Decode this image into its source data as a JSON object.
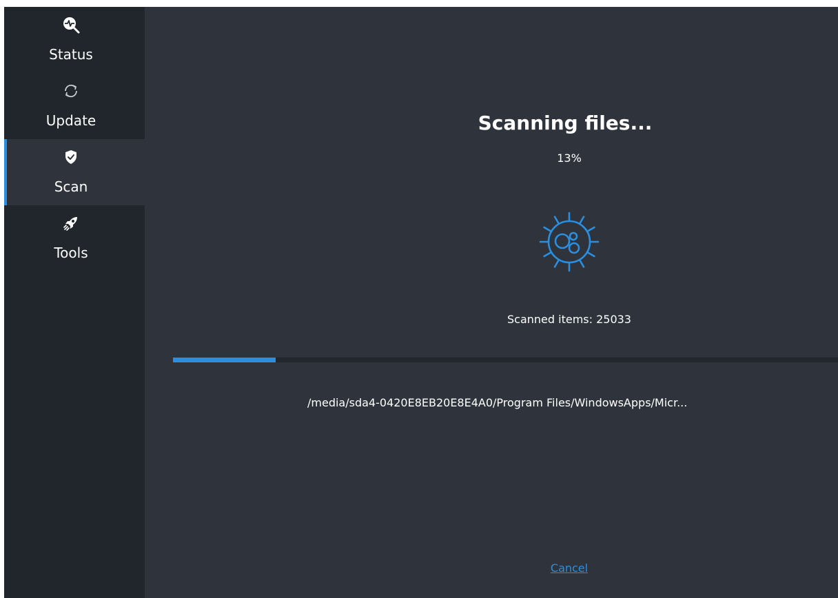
{
  "sidebar": {
    "items": [
      {
        "label": "Status",
        "icon": "status-icon"
      },
      {
        "label": "Update",
        "icon": "update-icon"
      },
      {
        "label": "Scan",
        "icon": "shield-check-icon",
        "active": true
      },
      {
        "label": "Tools",
        "icon": "rocket-icon"
      }
    ]
  },
  "scan": {
    "title": "Scanning files...",
    "percent": "13%",
    "progress_fraction": 0.13,
    "scanned_items": "Scanned items: 25033",
    "current_file": "/media/sda4-0420E8EB20E8E4A0/Program Files/WindowsApps/Micr...",
    "cancel_label": "Cancel"
  },
  "colors": {
    "accent": "#2a8fe0",
    "sidebar_bg": "#20262b",
    "main_bg": "#2f343c",
    "text": "#ffffff"
  }
}
